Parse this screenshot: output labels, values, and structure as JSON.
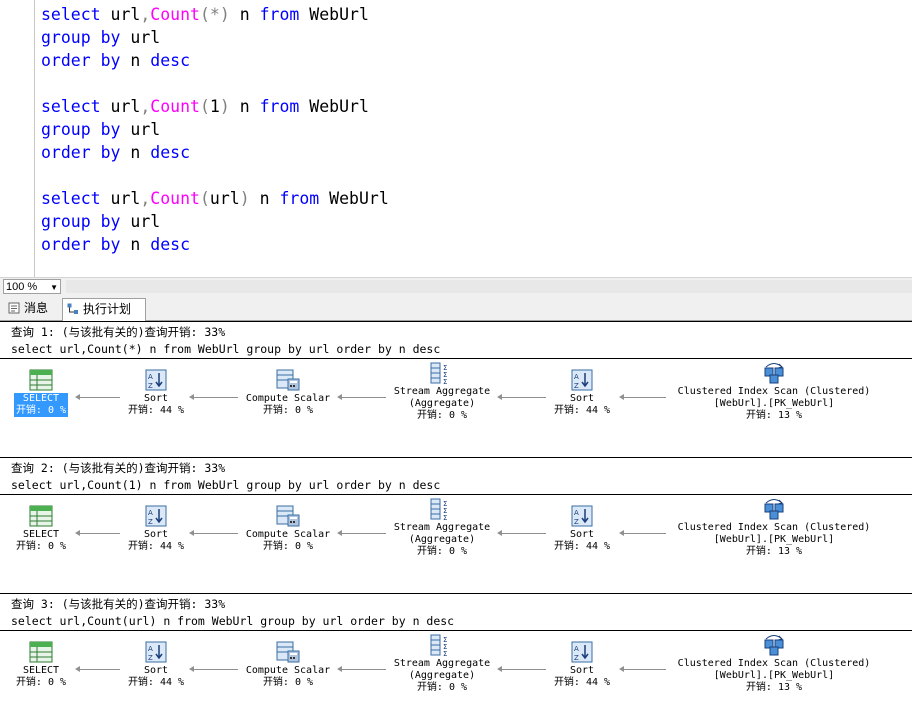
{
  "editor": {
    "lines": [
      {
        "parts": [
          [
            "kw",
            "select "
          ],
          [
            "id",
            "url"
          ],
          [
            "op",
            ","
          ],
          [
            "fn",
            "Count"
          ],
          [
            "op",
            "(*)"
          ],
          [
            "id",
            " n "
          ],
          [
            "kw",
            "from"
          ],
          [
            "id",
            " WebUrl"
          ]
        ]
      },
      {
        "parts": [
          [
            "kw",
            "group by "
          ],
          [
            "id",
            "url"
          ]
        ]
      },
      {
        "parts": [
          [
            "kw",
            "order by "
          ],
          [
            "id",
            "n "
          ],
          [
            "kw",
            "desc"
          ]
        ]
      },
      {
        "parts": []
      },
      {
        "parts": [
          [
            "kw",
            "select "
          ],
          [
            "id",
            "url"
          ],
          [
            "op",
            ","
          ],
          [
            "fn",
            "Count"
          ],
          [
            "op",
            "("
          ],
          [
            "id",
            "1"
          ],
          [
            "op",
            ")"
          ],
          [
            "id",
            " n "
          ],
          [
            "kw",
            "from"
          ],
          [
            "id",
            " WebUrl"
          ]
        ]
      },
      {
        "parts": [
          [
            "kw",
            "group by "
          ],
          [
            "id",
            "url"
          ]
        ]
      },
      {
        "parts": [
          [
            "kw",
            "order by "
          ],
          [
            "id",
            "n "
          ],
          [
            "kw",
            "desc"
          ]
        ]
      },
      {
        "parts": []
      },
      {
        "parts": [
          [
            "kw",
            "select "
          ],
          [
            "id",
            "url"
          ],
          [
            "op",
            ","
          ],
          [
            "fn",
            "Count"
          ],
          [
            "op",
            "("
          ],
          [
            "id",
            "url"
          ],
          [
            "op",
            ")"
          ],
          [
            "id",
            " n "
          ],
          [
            "kw",
            "from"
          ],
          [
            "id",
            " WebUrl"
          ]
        ]
      },
      {
        "parts": [
          [
            "kw",
            "group by "
          ],
          [
            "id",
            "url"
          ]
        ]
      },
      {
        "parts": [
          [
            "kw",
            "order by "
          ],
          [
            "id",
            "n "
          ],
          [
            "kw",
            "desc"
          ]
        ]
      }
    ]
  },
  "zoom": {
    "value": "100 %"
  },
  "tabs": {
    "messages": "消息",
    "plan": "执行计划"
  },
  "queries": [
    {
      "header": "查询 1: (与该批有关的)查询开销: 33%",
      "sql": "select url,Count(*) n from WebUrl group by url order by n desc",
      "selected": true
    },
    {
      "header": "查询 2: (与该批有关的)查询开销: 33%",
      "sql": "select url,Count(1) n from WebUrl group by url order by n desc",
      "selected": false
    },
    {
      "header": "查询 3: (与该批有关的)查询开销: 33%",
      "sql": "select url,Count(url) n from WebUrl group by url order by n desc",
      "selected": false
    }
  ],
  "ops": {
    "select": {
      "name": "SELECT",
      "cost": "开销: 0 %"
    },
    "sort1": {
      "name": "Sort",
      "cost": "开销: 44 %"
    },
    "compute": {
      "name": "Compute Scalar",
      "cost": "开销: 0 %"
    },
    "stream": {
      "name": "Stream Aggregate",
      "sub": "(Aggregate)",
      "cost": "开销: 0 %"
    },
    "sort2": {
      "name": "Sort",
      "cost": "开销: 44 %"
    },
    "scan": {
      "name": "Clustered Index Scan (Clustered)",
      "sub": "[WebUrl].[PK_WebUrl]",
      "cost": "开销: 13 %"
    }
  }
}
